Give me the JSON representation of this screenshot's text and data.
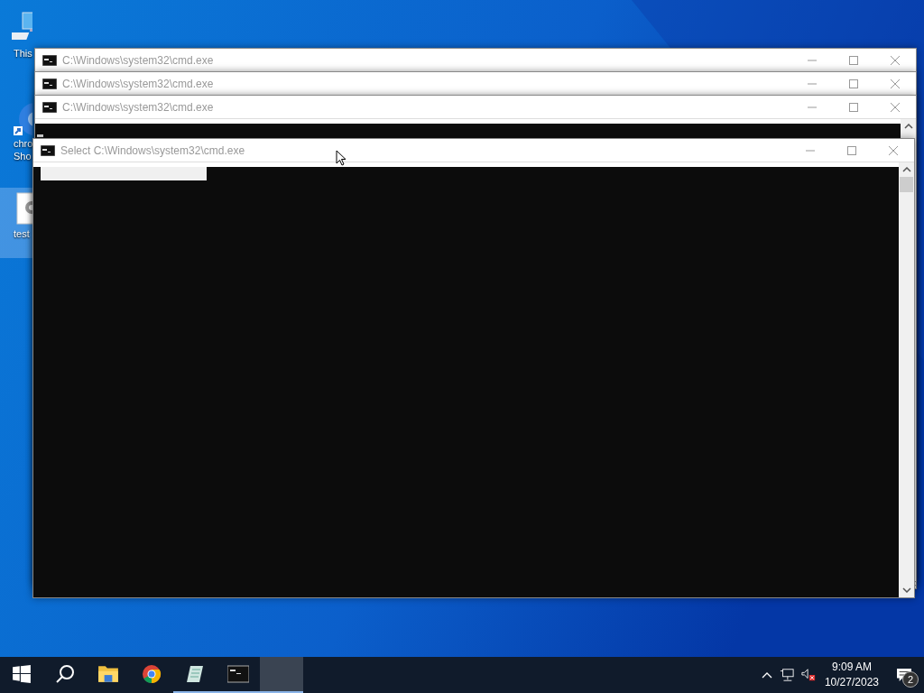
{
  "desktop_icons": [
    {
      "kind": "computer",
      "lines": [
        "This"
      ],
      "selected": false
    },
    {
      "kind": "chrome",
      "lines": [
        "chro",
        "Sho"
      ],
      "selected": false
    },
    {
      "kind": "file",
      "lines": [
        "test"
      ],
      "selected": true
    }
  ],
  "windows": [
    {
      "title": "C:\\Windows\\system32\\cmd.exe"
    },
    {
      "title": "C:\\Windows\\system32\\cmd.exe"
    },
    {
      "title": "C:\\Windows\\system32\\cmd.exe"
    },
    {
      "title": "Select C:\\Windows\\system32\\cmd.exe"
    }
  ],
  "taskbar": {
    "apps": [
      {
        "kind": "start",
        "running": false,
        "selected": false
      },
      {
        "kind": "search",
        "running": false,
        "selected": false
      },
      {
        "kind": "explorer",
        "running": false,
        "selected": false
      },
      {
        "kind": "chrome",
        "running": false,
        "selected": false
      },
      {
        "kind": "notepad",
        "running": true,
        "selected": false
      },
      {
        "kind": "cmd",
        "running": true,
        "selected": false
      },
      {
        "kind": "blank",
        "running": true,
        "selected": true
      }
    ],
    "time": "9:09 AM",
    "date": "10/27/2023",
    "notifications": "2"
  }
}
